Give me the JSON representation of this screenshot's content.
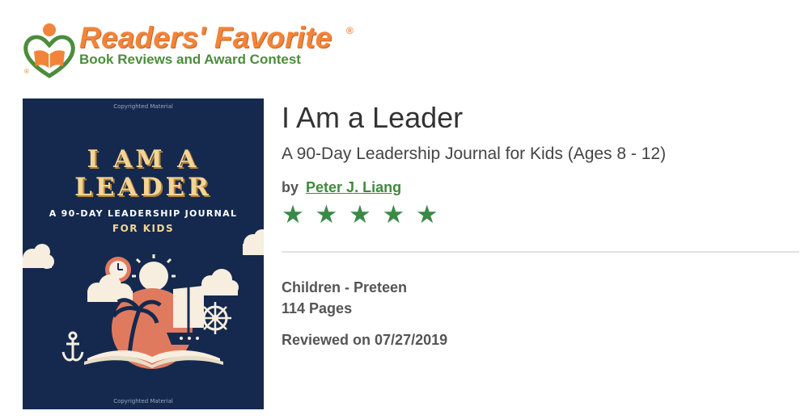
{
  "logo": {
    "title": "Readers' Favorite",
    "registered": "®",
    "subtitle": "Book Reviews and Award Contest"
  },
  "cover": {
    "copyright_top": "Copyrighted Material",
    "title_line1": "I AM A",
    "title_line2": "LEADER",
    "subtitle": "A 90-DAY LEADERSHIP JOURNAL",
    "audience": "FOR KIDS",
    "copyright_bottom": "Copyrighted Material"
  },
  "book": {
    "title": "I Am a Leader",
    "subtitle": "A 90-Day Leadership Journal for Kids (Ages 8 - 12)",
    "by_label": "by",
    "author": "Peter J. Liang",
    "rating": 5,
    "rating_max": 5,
    "genre": "Children - Preteen",
    "pages": "114 Pages",
    "reviewed": "Reviewed on 07/27/2019"
  },
  "colors": {
    "brand_orange": "#f1843a",
    "brand_green": "#4c8c3c",
    "star_green": "#3a8a47",
    "link_green": "#3f8a3f",
    "cover_navy": "#15294e"
  },
  "icons": {
    "logo": "reader-heart-logo",
    "star": "star-icon"
  }
}
